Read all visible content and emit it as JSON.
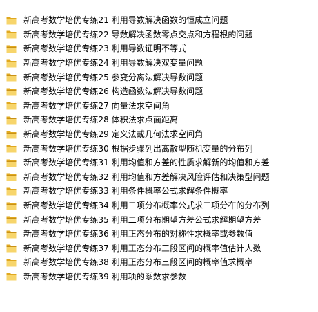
{
  "folder_icon": {
    "icon": "folder-icon",
    "back_color": "#E0A81F",
    "front_color": "#F7D56B",
    "edge_color": "#C99116"
  },
  "items": [
    {
      "name": "新高考数学培优专练21 利用导数解决函数的恒成立问题"
    },
    {
      "name": "新高考数学培优专练22 导数解决函数零点交点和方程根的问题"
    },
    {
      "name": "新高考数学培优专练23 利用导数证明不等式"
    },
    {
      "name": "新高考数学培优专练24 利用导数解决双变量问题"
    },
    {
      "name": "新高考数学培优专练25 参变分离法解决导数问题"
    },
    {
      "name": "新高考数学培优专练26 构造函数法解决导数问题"
    },
    {
      "name": "新高考数学培优专练27 向量法求空间角"
    },
    {
      "name": "新高考数学培优专练28 体积法求点面距离"
    },
    {
      "name": "新高考数学培优专练29 定义法或几何法求空间角"
    },
    {
      "name": "新高考数学培优专练30 根据步骤列出离散型随机变量的分布列"
    },
    {
      "name": "新高考数学培优专练31 利用均值和方差的性质求解新的均值和方差"
    },
    {
      "name": "新高考数学培优专练32 利用均值和方差解决风险评估和决策型问题"
    },
    {
      "name": "新高考数学培优专练33 利用条件概率公式求解条件概率"
    },
    {
      "name": "新高考数学培优专练34 利用二项分布概率公式求二项分布的分布列"
    },
    {
      "name": "新高考数学培优专练35 利用二项分布期望方差公式求解期望方差"
    },
    {
      "name": "新高考数学培优专练36 利用正态分布的对称性求概率或参数值"
    },
    {
      "name": "新高考数学培优专练37 利用正态分布三段区间的概率值估计人数"
    },
    {
      "name": "新高考数学培优专练38 利用正态分布三段区间的概率值求概率"
    },
    {
      "name": "新高考数学培优专练39 利用项的系数求参数"
    }
  ]
}
